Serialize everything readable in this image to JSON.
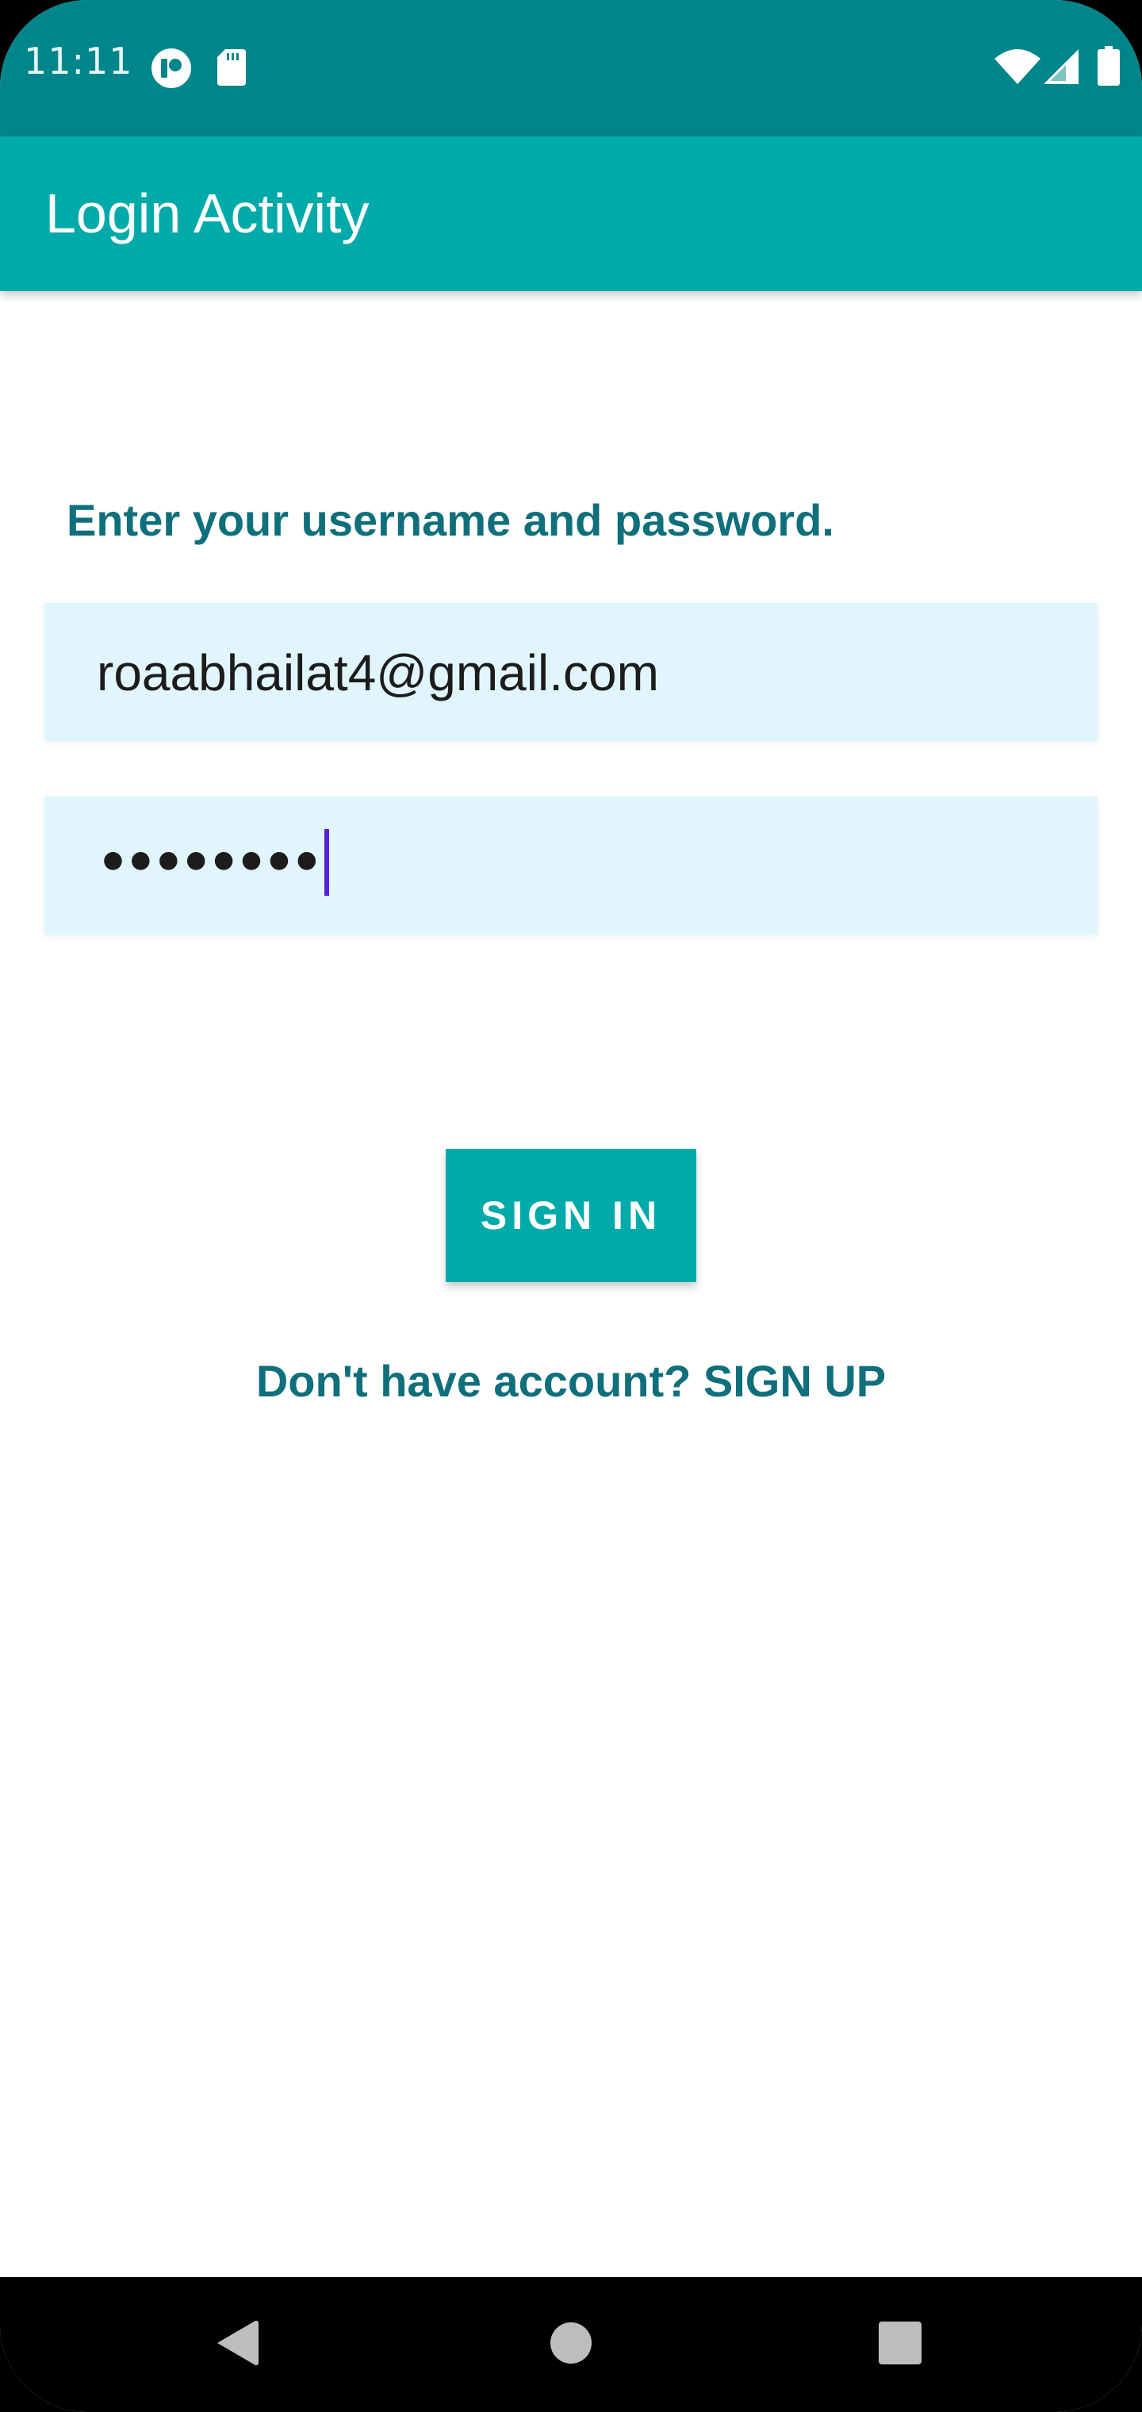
{
  "status_bar": {
    "time": "11:11",
    "icons": [
      "cloud-sync-icon",
      "sd-card-icon",
      "wifi-icon",
      "signal-icon",
      "battery-icon"
    ],
    "color": "#00868a"
  },
  "app_bar": {
    "title": "Login Activity",
    "color": "#00aaa9"
  },
  "form": {
    "instruction": "Enter your username and password.",
    "username_value": "roaabhailat4@gmail.com",
    "password_masked": "••••••••",
    "field_background": "#e1f5fd"
  },
  "actions": {
    "sign_in_label": "SIGN IN",
    "signup_link_text": "Don't have account? SIGN UP",
    "accent_color": "#00aaa9",
    "text_color": "#0f6f7b"
  },
  "nav_bar": {
    "buttons": [
      "back-icon",
      "home-icon",
      "recents-icon"
    ]
  }
}
